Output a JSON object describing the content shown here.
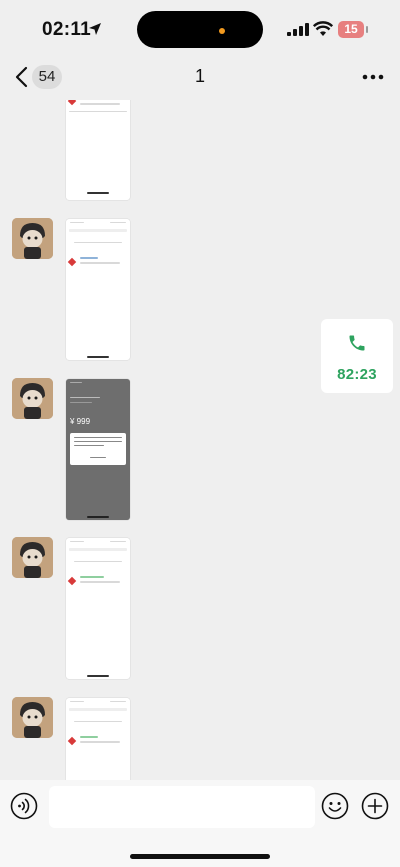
{
  "status_bar": {
    "time": "02:11",
    "battery": "15",
    "icons": [
      "location-arrow-icon",
      "cellular-signal-icon",
      "wifi-icon",
      "battery-icon"
    ]
  },
  "nav": {
    "back_count": "54",
    "title": "1",
    "icons": [
      "back-chevron-icon",
      "more-icon"
    ]
  },
  "call": {
    "duration": "82:23",
    "icon": "phone-icon",
    "accent": "#2ea35f"
  },
  "thumbnails": [
    {
      "dark": false
    },
    {
      "dark": false
    },
    {
      "dark": true,
      "price": "¥ 999"
    },
    {
      "dark": false
    },
    {
      "dark": false
    }
  ],
  "input_bar": {
    "placeholder": "",
    "icons": [
      "voice-icon",
      "emoji-icon",
      "plus-icon"
    ]
  }
}
